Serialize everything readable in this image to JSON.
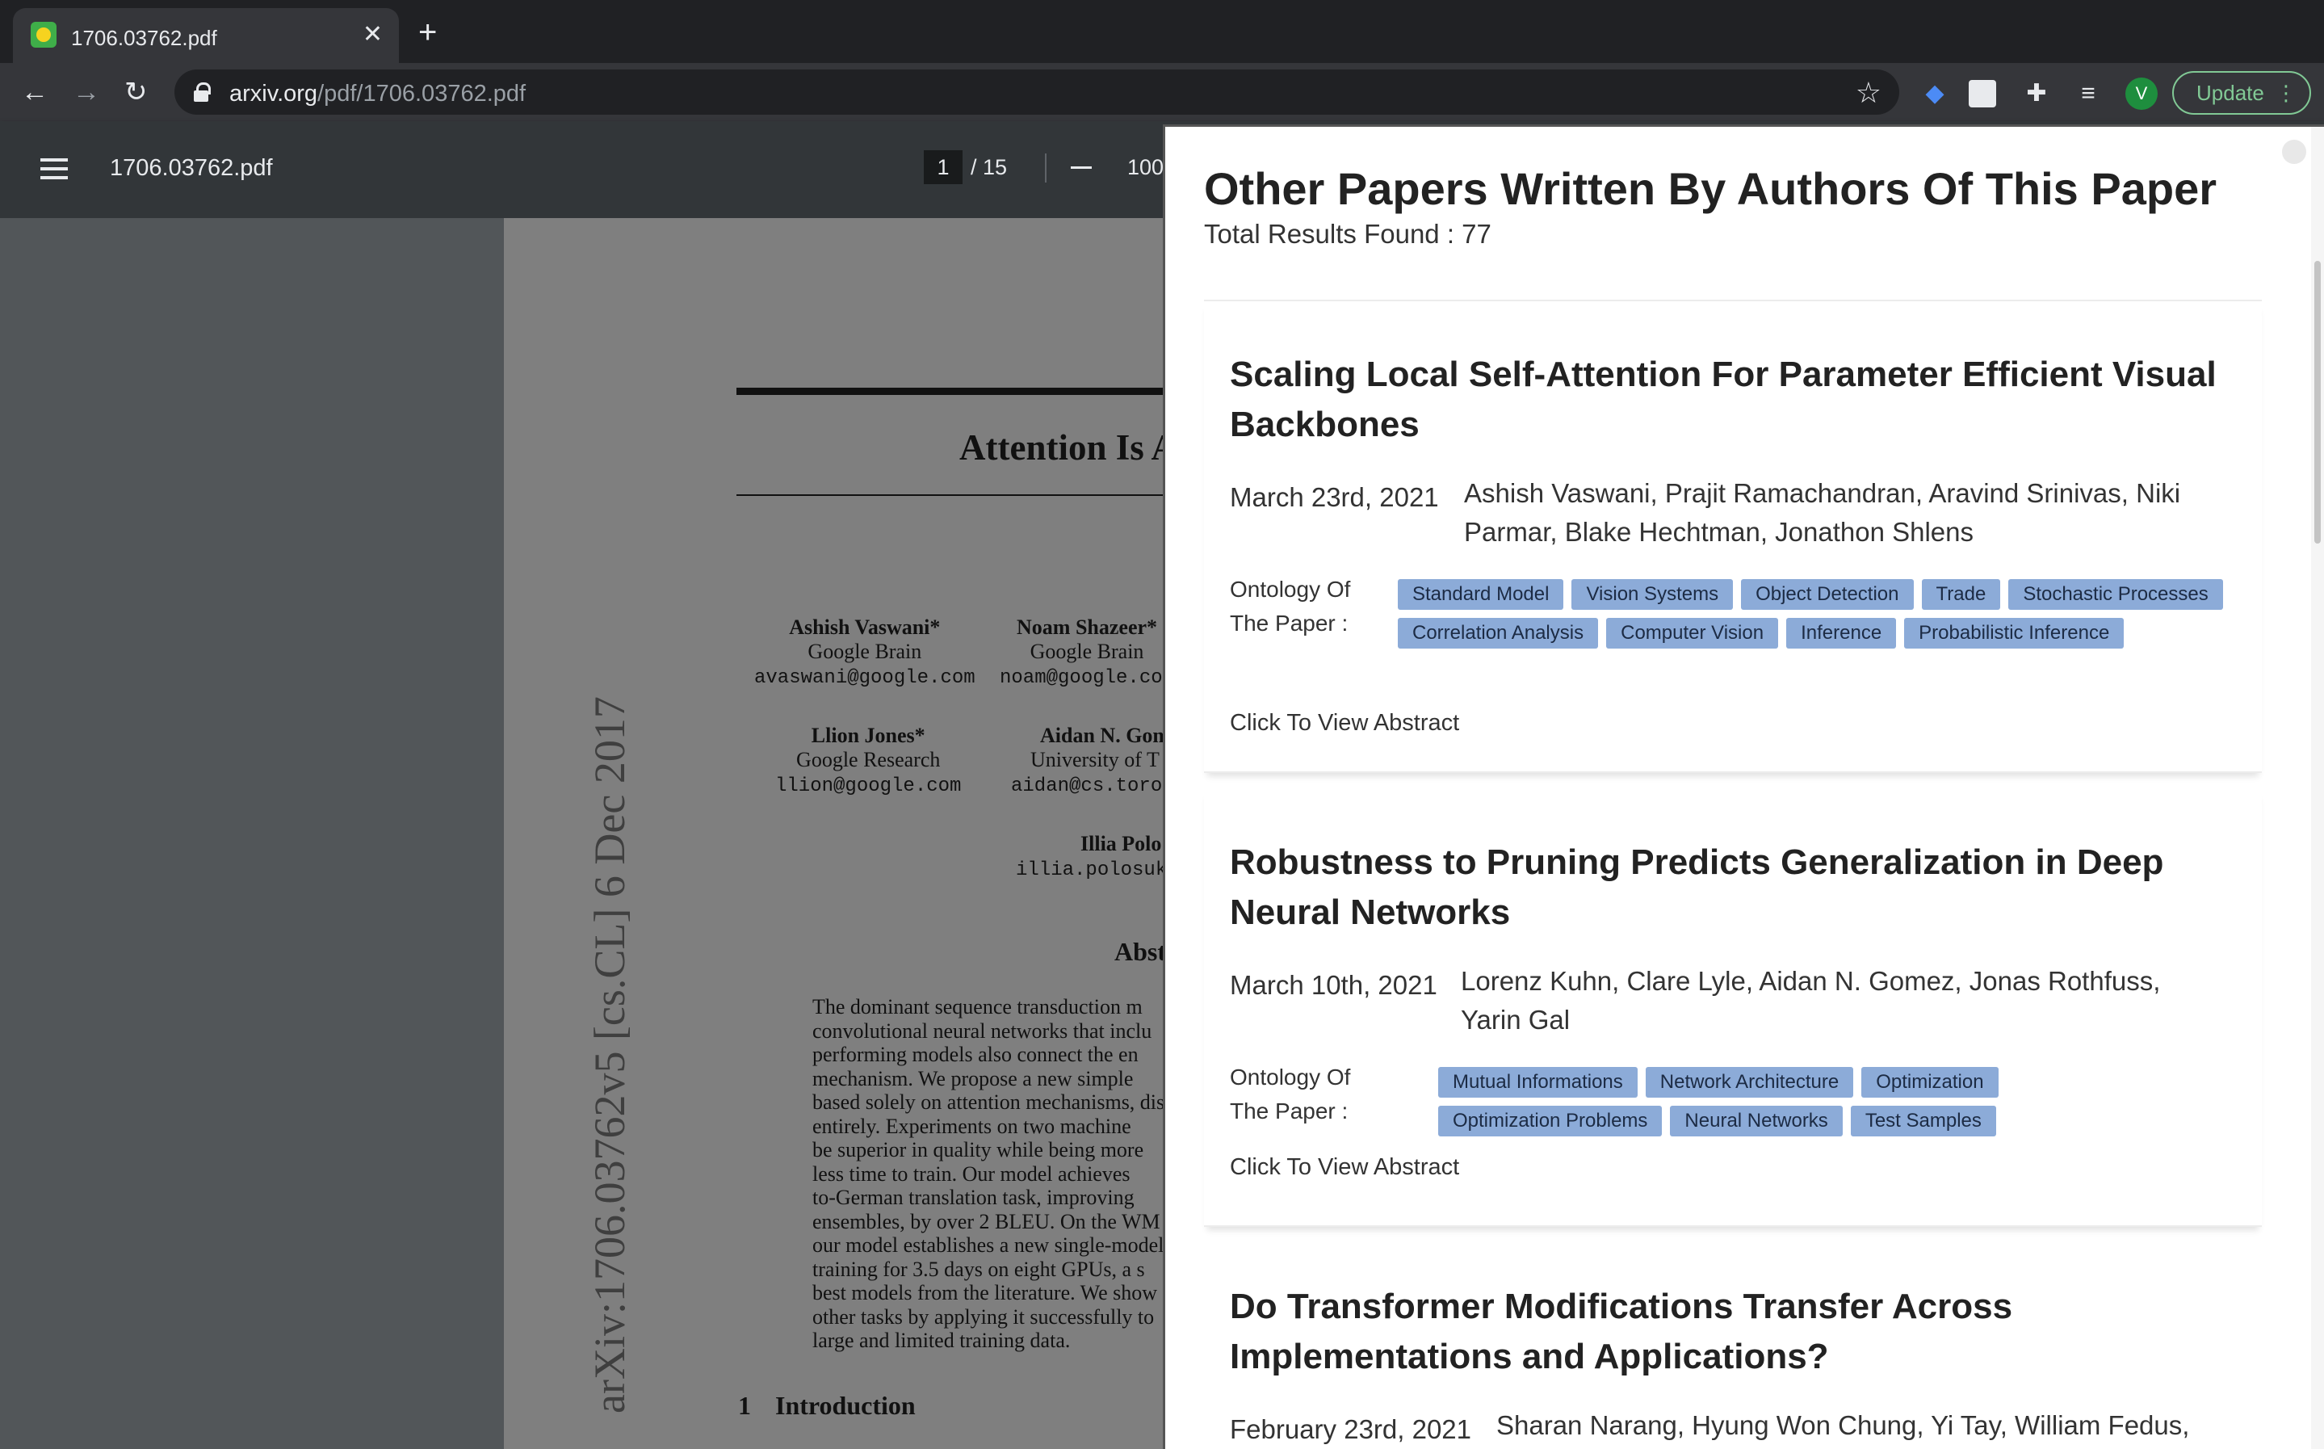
{
  "browser": {
    "tab_title": "1706.03762.pdf",
    "tab_close": "✕",
    "new_tab": "+",
    "url_host": "arxiv.org",
    "url_path": "/pdf/1706.03762.pdf",
    "update_label": "Update",
    "profile_initial": "V",
    "icons": [
      "back-arrow-icon",
      "forward-arrow-icon",
      "reload-icon",
      "lock-icon",
      "star-icon",
      "extension-icon",
      "puzzle-icon",
      "reading-list-icon",
      "more-icon"
    ]
  },
  "pdf_viewer": {
    "filename": "1706.03762.pdf",
    "current_page": "1",
    "total_pages": "/ 15",
    "zoom": "100"
  },
  "pdf_page": {
    "title": "Attention Is A",
    "authors": [
      {
        "name": "Ashish Vaswani*",
        "org": "Google Brain",
        "email": "avaswani@google.com"
      },
      {
        "name": "Noam Shazeer*",
        "org": "Google Brain",
        "email": "noam@google.com"
      },
      {
        "name": "Llion Jones*",
        "org": "Google Research",
        "email": "llion@google.com"
      },
      {
        "name": "Aidan N. Gom",
        "org": "University of T",
        "email": "aidan@cs.toron"
      },
      {
        "name": "Illia Polo",
        "org": "",
        "email": "illia.polosuk"
      }
    ],
    "arxiv_stamp": "arXiv:1706.03762v5  [cs.CL]  6 Dec 2017",
    "abstract_heading": "Abst",
    "abstract_lines": [
      "The dominant sequence transduction m",
      "convolutional neural networks that inclu",
      "performing models also connect the en",
      "mechanism.  We propose a new simple",
      "based solely on attention mechanisms, dis",
      "entirely.  Experiments on two machine",
      "be superior in quality while being more",
      "less time to train.  Our model achieves",
      "to-German translation task, improving",
      "ensembles, by over 2 BLEU. On the WM",
      "our model establishes a new single-model",
      "training for 3.5 days on eight GPUs, a s",
      "best models from the literature. We show",
      "other tasks by applying it successfully to",
      "large and limited training data."
    ],
    "intro_number": "1",
    "intro_heading": "Introduction"
  },
  "panel": {
    "title": "Other Papers Written By Authors Of This Paper",
    "total_results": "Total Results Found : 77",
    "ontology_label": "Ontology Of The Paper :",
    "view_abstract": "Click To View Abstract",
    "papers": [
      {
        "title": "Scaling Local Self-Attention For Parameter Efficient Visual Backbones",
        "date": "March 23rd, 2021",
        "authors": "Ashish Vaswani, Prajit Ramachandran, Aravind Srinivas, Niki Parmar, Blake Hechtman, Jonathon Shlens",
        "tags": [
          "Standard Model",
          "Vision Systems",
          "Object Detection",
          "Trade",
          "Stochastic Processes",
          "Correlation Analysis",
          "Computer Vision",
          "Inference",
          "Probabilistic Inference"
        ]
      },
      {
        "title": "Robustness to Pruning Predicts Generalization in Deep Neural Networks",
        "date": "March 10th, 2021",
        "authors": "Lorenz Kuhn, Clare Lyle, Aidan N. Gomez, Jonas Rothfuss, Yarin Gal",
        "tags": [
          "Mutual Informations",
          "Network Architecture",
          "Optimization",
          "Optimization Problems",
          "Neural Networks",
          "Test Samples"
        ]
      },
      {
        "title": "Do Transformer Modifications Transfer Across Implementations and Applications?",
        "date": "February 23rd, 2021",
        "authors": "Sharan Narang, Hyung Won Chung, Yi Tay, William Fedus,",
        "tags": []
      }
    ]
  }
}
